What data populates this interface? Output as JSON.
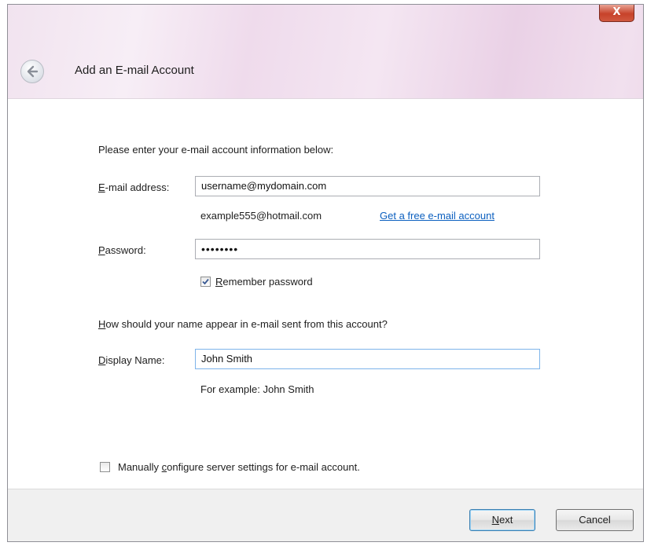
{
  "window": {
    "title": "Add an E-mail Account",
    "close_glyph": "X"
  },
  "intro": "Please enter your e-mail account information below:",
  "email": {
    "label_prefix": "",
    "label_key": "E",
    "label_rest": "-mail address:",
    "value": "username@mydomain.com",
    "example": "example555@hotmail.com",
    "free_link": "Get a free e-mail account"
  },
  "password": {
    "label_key": "P",
    "label_rest": "assword:",
    "masked_value": "••••••••"
  },
  "remember": {
    "checked": true,
    "label_key": "R",
    "label_rest": "emember password"
  },
  "question": {
    "label_key": "H",
    "label_rest": "ow should your name appear in e-mail sent from this account?"
  },
  "display_name": {
    "label_key": "D",
    "label_rest": "isplay Name:",
    "value": "John Smith",
    "example": "For example: John Smith"
  },
  "manual": {
    "checked": false,
    "label_pre": "Manually ",
    "label_key": "c",
    "label_rest": "onfigure server settings for e-mail account."
  },
  "buttons": {
    "next_key": "N",
    "next_rest": "ext",
    "cancel": "Cancel"
  },
  "colors": {
    "accent_border": "#7eb4ea",
    "link": "#0b5fbf",
    "close": "#c7422a"
  }
}
